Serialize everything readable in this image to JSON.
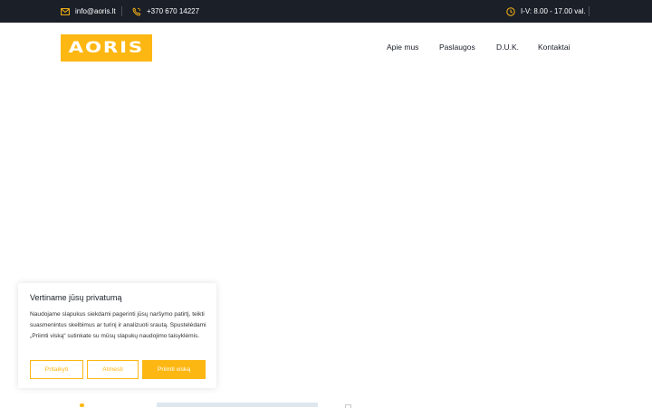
{
  "topbar": {
    "email": "info@aoris.lt",
    "phone": "+370 670 14227",
    "hours": "I-V: 8.00 - 17.00 val.",
    "icons": [
      "mail-icon",
      "phone-icon",
      "clock-icon"
    ]
  },
  "header": {
    "logo_text": "AORIS",
    "nav": [
      "Apie mus",
      "Paslaugos",
      "D.U.K.",
      "Kontaktai"
    ]
  },
  "cookie": {
    "title": "Vertiname jūsų privatumą",
    "text": "Naudojame slapukus siekdami pagerinti jūsų naršymo patirtį, teikti suasmenintus skelbimus ar turinį ir analizuoti srautą. Spustelėdami „Priimti viską“ sutinkate su mūsų slapukų naudojimo taisyklėmis.",
    "customize_label": "Pritaikyti",
    "reject_label": "Atmesti",
    "accept_label": "Priimti viską"
  },
  "colors": {
    "brand": "#fdb713",
    "topbar_bg": "#1a1f28",
    "text": "#1a1f28"
  }
}
